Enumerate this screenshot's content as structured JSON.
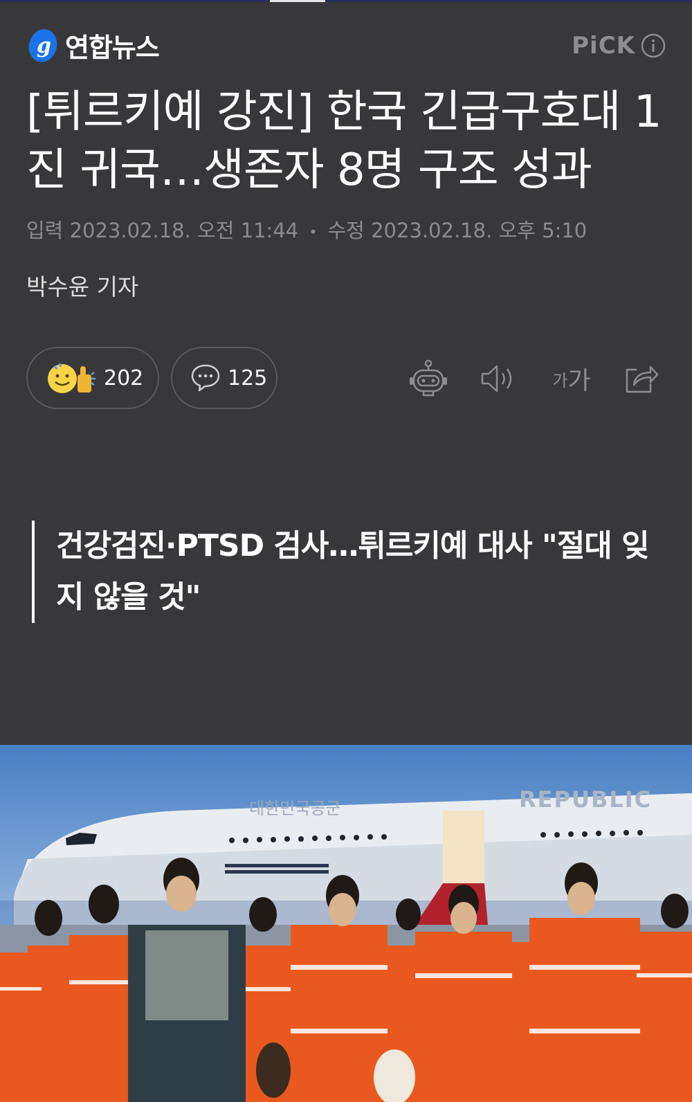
{
  "header": {
    "logo_text": "연합뉴스",
    "pick_label": "PiCK",
    "logo_color": "#1a73e8"
  },
  "reading_progress": 0.08,
  "article": {
    "title": "[튀르키예 강진] 한국 긴급구호대 1진 귀국…생존자 8명 구조 성과",
    "meta": {
      "input_label": "입력",
      "input_time": "2023.02.18. 오전 11:44",
      "edit_label": "수정",
      "edit_time": "2023.02.18. 오후 5:10"
    },
    "reporter": "박수윤 기자",
    "subheadline": "건강검진·PTSD 검사…튀르키예 대사 \"절대 잊지 않을 것\""
  },
  "actions": {
    "reaction_count": "202",
    "comment_count": "125",
    "font_small": "가",
    "font_large": "가",
    "icons": [
      "reaction-icon",
      "comment-icon",
      "ai-summary-robot-icon",
      "speaker-icon",
      "font-size-icon",
      "share-icon"
    ]
  },
  "photo": {
    "plane_text_korean": "대한민국공군",
    "plane_text_english": "REPUBLIC"
  }
}
